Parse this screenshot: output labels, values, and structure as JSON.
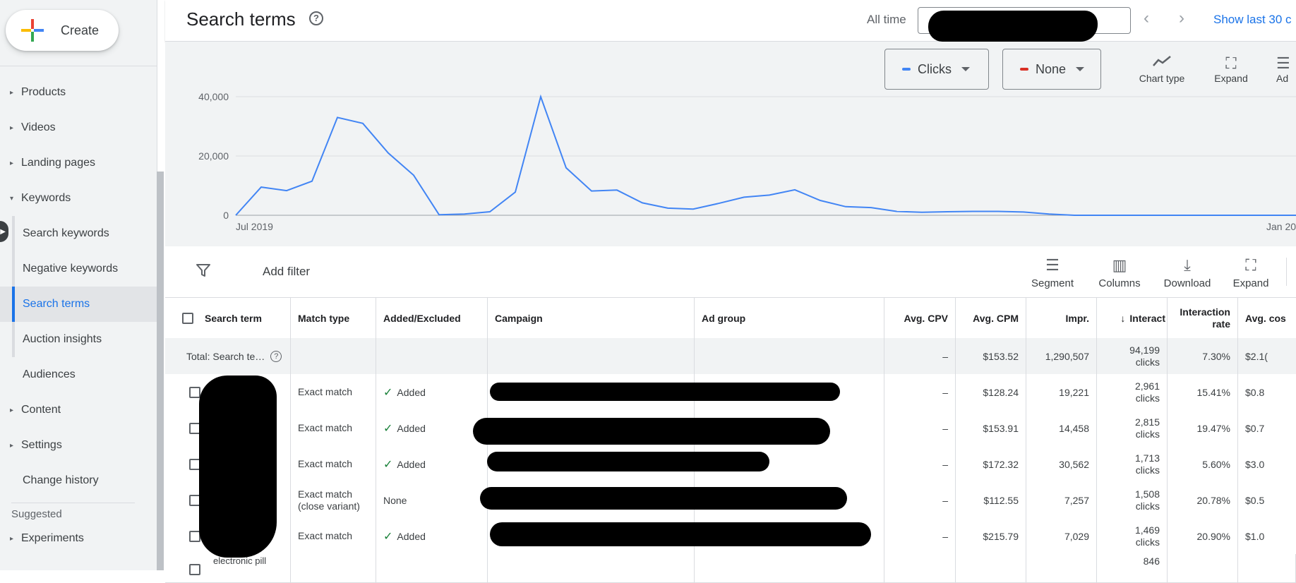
{
  "create_label": "Create",
  "sidebar": {
    "items": [
      {
        "label": "Products",
        "caret": "▸"
      },
      {
        "label": "Videos",
        "caret": "▸"
      },
      {
        "label": "Landing pages",
        "caret": "▸"
      },
      {
        "label": "Keywords",
        "caret": "▾"
      },
      {
        "label": "Search keywords"
      },
      {
        "label": "Negative keywords"
      },
      {
        "label": "Search terms"
      },
      {
        "label": "Auction insights"
      },
      {
        "label": "Audiences"
      },
      {
        "label": "Content",
        "caret": "▸"
      },
      {
        "label": "Settings",
        "caret": "▸"
      },
      {
        "label": "Change history"
      },
      {
        "label": "Experiments",
        "caret": "▸"
      }
    ],
    "suggested_label": "Suggested"
  },
  "header": {
    "title": "Search terms",
    "range_label": "All time",
    "show_last": "Show last 30 c"
  },
  "chart_controls": {
    "metric1": "Clicks",
    "metric1_color": "#4285f4",
    "metric2": "None",
    "metric2_color": "#d93025",
    "tools": [
      "Chart type",
      "Expand",
      "Ad"
    ]
  },
  "chart_data": {
    "type": "line",
    "series": [
      {
        "values": [
          0,
          9500,
          8300,
          11500,
          33000,
          31000,
          21000,
          13500,
          200,
          400,
          1200,
          7800,
          40000,
          16000,
          8200,
          8500,
          4200,
          2400,
          2100,
          4000,
          6100,
          6800,
          8600,
          5000,
          2900,
          2600,
          1300,
          1000,
          1200,
          1300,
          1300,
          1100,
          400,
          0,
          0,
          0,
          0,
          0,
          0,
          0,
          0,
          0,
          0,
          0,
          0,
          0,
          0,
          0,
          0,
          0,
          0
        ],
        "color": "#4285f4"
      }
    ],
    "x_labels": [
      "Jul 2019",
      "Jan 20"
    ],
    "y_ticks": [
      "0",
      "20,000",
      "40,000"
    ],
    "ylim": [
      0,
      40000
    ],
    "grid": true
  },
  "table_toolbar": {
    "add_filter": "Add filter",
    "tools": [
      "Segment",
      "Columns",
      "Download",
      "Expand"
    ]
  },
  "table": {
    "columns": [
      "Search term",
      "Match type",
      "Added/Excluded",
      "Campaign",
      "Ad group",
      "Avg. CPV",
      "Avg. CPM",
      "Impr.",
      "Interact",
      "Interaction rate",
      "Avg. cos"
    ],
    "sort_arrow": "↓",
    "total": {
      "label": "Total: Search te…",
      "avg_cpv": "–",
      "avg_cpm": "$153.52",
      "impr": "1,290,507",
      "interactions": "94,199",
      "interactions_unit": "clicks",
      "rate": "7.30%",
      "avg_cost": "$2.1("
    },
    "rows": [
      {
        "match": "Exact match",
        "added": "Added",
        "avg_cpv": "–",
        "avg_cpm": "$128.24",
        "impr": "19,221",
        "interactions": "2,961",
        "unit": "clicks",
        "rate": "15.41%",
        "avg_cost": "$0.8"
      },
      {
        "match": "Exact match",
        "added": "Added",
        "avg_cpv": "–",
        "avg_cpm": "$153.91",
        "impr": "14,458",
        "interactions": "2,815",
        "unit": "clicks",
        "rate": "19.47%",
        "avg_cost": "$0.7"
      },
      {
        "match": "Exact match",
        "added": "Added",
        "avg_cpv": "–",
        "avg_cpm": "$172.32",
        "impr": "30,562",
        "interactions": "1,713",
        "unit": "clicks",
        "rate": "5.60%",
        "avg_cost": "$3.0"
      },
      {
        "match": "Exact match\n(close variant)",
        "added": "None",
        "avg_cpv": "–",
        "avg_cpm": "$112.55",
        "impr": "7,257",
        "interactions": "1,508",
        "unit": "clicks",
        "rate": "20.78%",
        "avg_cost": "$0.5"
      },
      {
        "match": "Exact match",
        "added": "Added",
        "avg_cpv": "–",
        "avg_cpm": "$215.79",
        "impr": "7,029",
        "interactions": "1,469",
        "unit": "clicks",
        "rate": "20.90%",
        "avg_cost": "$1.0"
      }
    ],
    "partial_row": {
      "term": "electronic pill",
      "interactions": "846"
    }
  }
}
